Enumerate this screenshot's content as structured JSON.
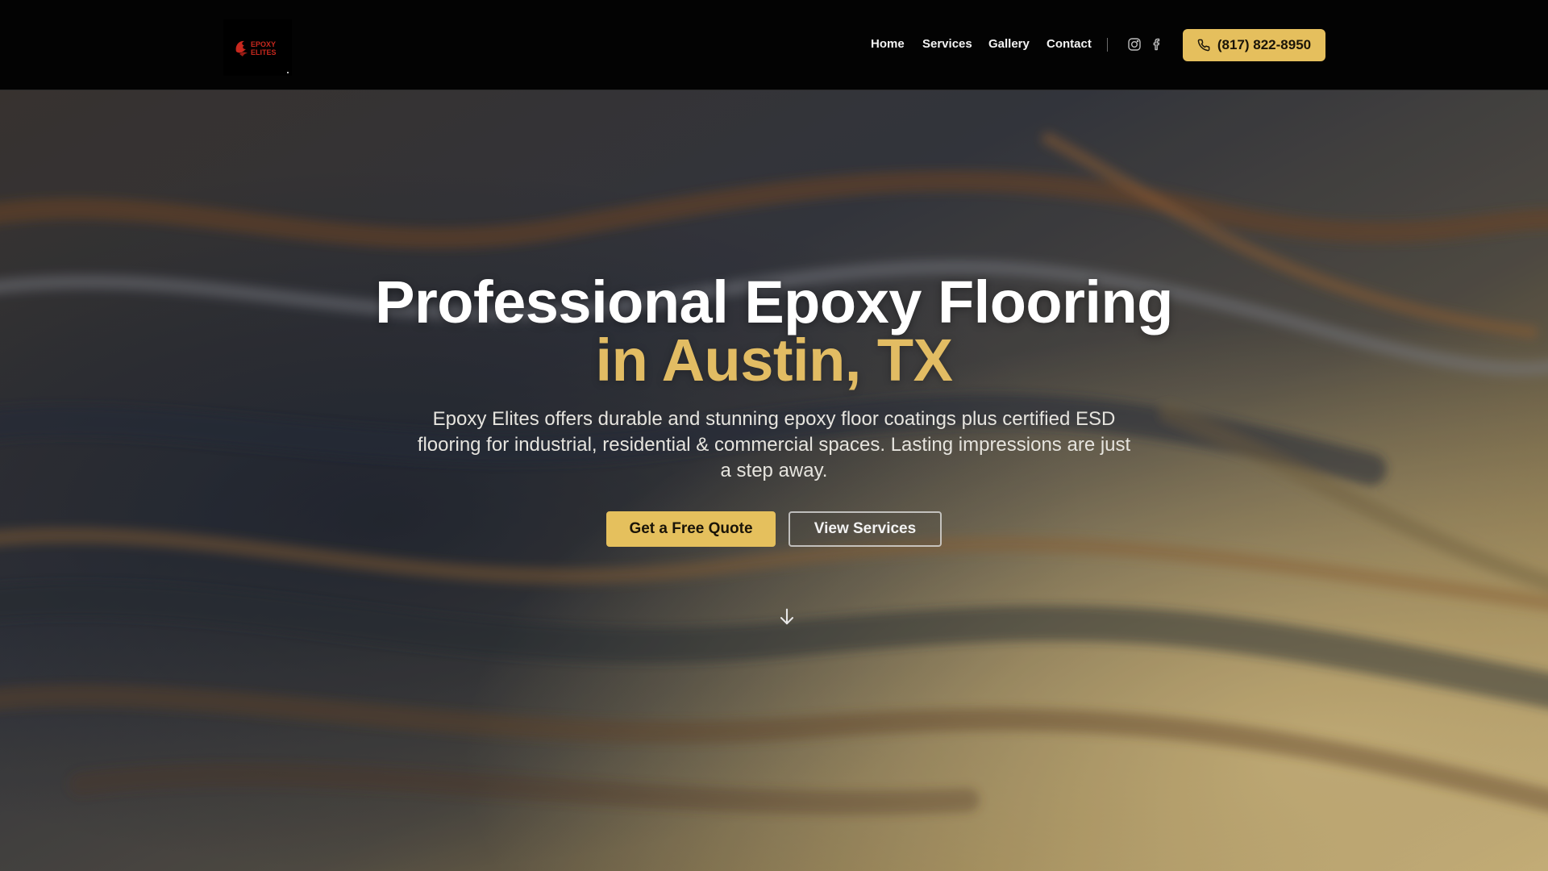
{
  "brand": {
    "logo_text_line1": "EPOXY",
    "logo_text_line2": "ELITES",
    "logo_color": "#c8281e"
  },
  "nav": {
    "links": [
      "Home",
      "Services",
      "Gallery",
      "Contact"
    ],
    "social_icons": [
      "instagram-icon",
      "facebook-icon"
    ],
    "phone_label": "(817) 822-8950",
    "phone_icon": "phone-icon"
  },
  "hero": {
    "headline_line1": "Professional Epoxy Flooring",
    "headline_line2": "in Austin, TX",
    "subtext": "Epoxy Elites offers durable and stunning epoxy floor coatings plus certified ESD flooring for industrial, residential & commercial spaces. Lasting impressions are just a step away.",
    "primary_cta": "Get a Free Quote",
    "secondary_cta": "View Services",
    "scroll_icon": "arrow-down-icon"
  },
  "colors": {
    "accent": "#e5c05d",
    "headline_accent": "#e2bc63",
    "nav_bg": "#030303"
  }
}
